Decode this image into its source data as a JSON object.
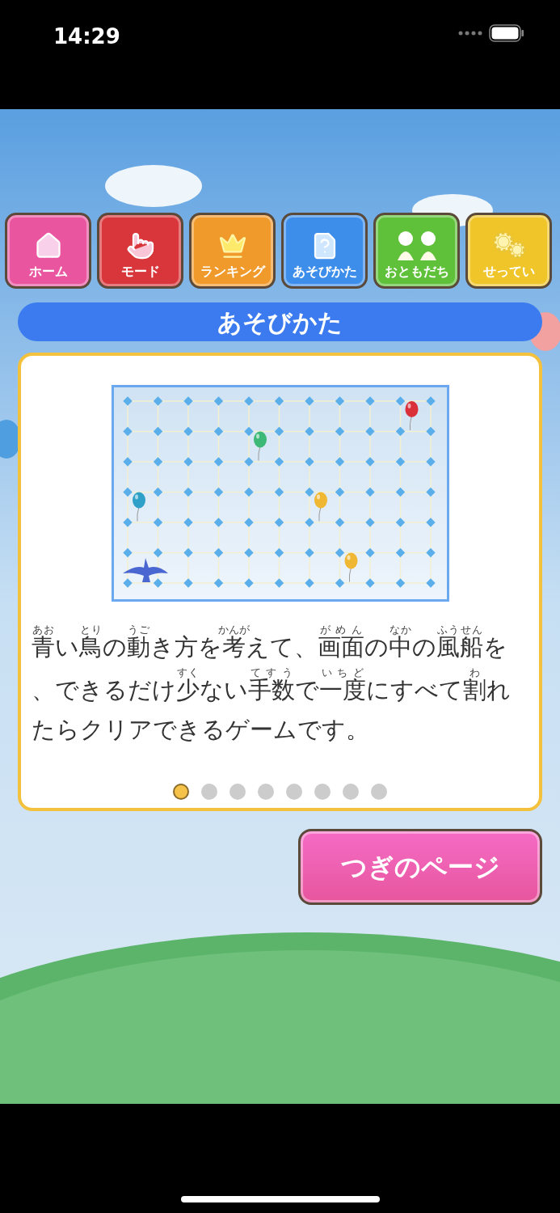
{
  "status_bar": {
    "time": "14:29"
  },
  "nav": [
    {
      "kind": "home",
      "label": "ホーム",
      "color": "#e9559f"
    },
    {
      "kind": "mode",
      "label": "モード",
      "color": "#d9363c"
    },
    {
      "kind": "ranking",
      "label": "ランキング",
      "color": "#f09a2c"
    },
    {
      "kind": "howto",
      "label": "あそびかた",
      "color": "#3d8eea"
    },
    {
      "kind": "friends",
      "label": "おともだち",
      "color": "#5fc13a"
    },
    {
      "kind": "settings",
      "label": "せってい",
      "color": "#efc52a"
    }
  ],
  "title": "あそびかた",
  "description": [
    [
      {
        "text": "青",
        "ruby": "あお"
      },
      {
        "text": "い"
      },
      {
        "text": "鳥",
        "ruby": "とり"
      },
      {
        "text": "の"
      },
      {
        "text": "動",
        "ruby": "うご"
      },
      {
        "text": "き方を"
      },
      {
        "text": "考",
        "ruby": "かんが"
      },
      {
        "text": "えて、"
      },
      {
        "text": "画面",
        "ruby": "がめん"
      },
      {
        "text": "の"
      },
      {
        "text": "中",
        "ruby": "なか"
      },
      {
        "text": "の"
      },
      {
        "text": "風船",
        "ruby": "ふうせん"
      },
      {
        "text": "を"
      }
    ],
    [
      {
        "text": "、できるだけ"
      },
      {
        "text": "少",
        "ruby": "すく"
      },
      {
        "text": "ない"
      },
      {
        "text": "手数",
        "ruby": "てすう"
      },
      {
        "text": "で"
      },
      {
        "text": "一度",
        "ruby": "いちど"
      },
      {
        "text": "にすべて"
      },
      {
        "text": "割",
        "ruby": "わ"
      },
      {
        "text": "れ"
      }
    ],
    [
      {
        "text": "たらクリアできるゲームです。"
      }
    ]
  ],
  "pages": [
    {
      "selected": true
    },
    {
      "selected": false
    },
    {
      "selected": false
    },
    {
      "selected": false
    },
    {
      "selected": false
    },
    {
      "selected": false
    },
    {
      "selected": false
    },
    {
      "selected": false
    }
  ],
  "next_button": "つぎのページ"
}
